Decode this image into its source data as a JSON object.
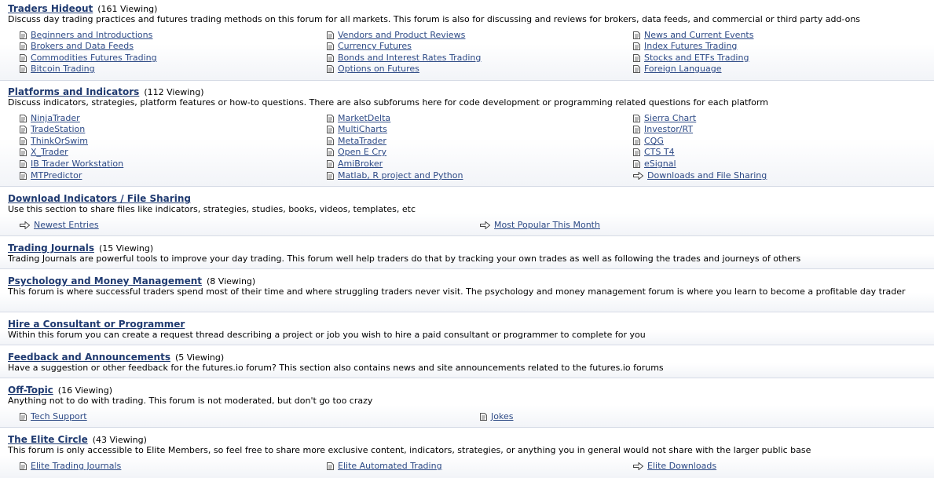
{
  "forums": {
    "traders_hideout": {
      "title": "Traders Hideout",
      "viewing": "(161 Viewing)",
      "description": "Discuss day trading practices and futures trading methods on this forum for all markets. This forum is also for discussing and reviews for brokers, data feeds, and commercial or third party add-ons",
      "subforums": [
        "Beginners and Introductions",
        "Brokers and Data Feeds",
        "Commodities Futures Trading",
        "Bitcoin Trading",
        "Vendors and Product Reviews",
        "Currency Futures",
        "Bonds and Interest Rates Trading",
        "Options on Futures",
        "News and Current Events",
        "Index Futures Trading",
        "Stocks and ETFs Trading",
        "Foreign Language"
      ]
    },
    "platforms": {
      "title": "Platforms and Indicators",
      "viewing": "(112 Viewing)",
      "description": "Discuss indicators, strategies, platform features or how-to questions. There are also subforums here for code development or programming related questions for each platform",
      "subforums": [
        "NinjaTrader",
        "TradeStation",
        "ThinkOrSwim",
        "X_Trader",
        "IB Trader Workstation",
        "MTPredictor",
        "MarketDelta",
        "MultiCharts",
        "MetaTrader",
        "Open E Cry",
        "AmiBroker",
        "Matlab, R project and Python",
        "Sierra Chart",
        "Investor/RT",
        "CQG",
        "CTS T4",
        "eSignal",
        "Downloads and File Sharing"
      ]
    },
    "download": {
      "title": "Download Indicators / File Sharing",
      "description": "Use this section to share files like indicators, strategies, studies, books, videos, templates, etc",
      "links": [
        "Newest Entries",
        "Most Popular This Month"
      ]
    },
    "journals": {
      "title": "Trading Journals",
      "viewing": "(15 Viewing)",
      "description": "Trading Journals are powerful tools to improve your day trading. This forum well help traders do that by tracking your own trades as well as following the trades and journeys of others"
    },
    "psychology": {
      "title": "Psychology and Money Management",
      "viewing": "(8 Viewing)",
      "description": "This forum is where successful traders spend most of their time and where struggling traders never visit. The psychology and money management forum is where you learn to become a profitable day trader"
    },
    "hire": {
      "title": "Hire a Consultant or Programmer",
      "description": "Within this forum you can create a request thread describing a project or job you wish to hire a paid consultant or programmer to complete for you"
    },
    "feedback": {
      "title": "Feedback and Announcements",
      "viewing": "(5 Viewing)",
      "description": "Have a suggestion or other feedback for the futures.io forum? This section also contains news and site announcements related to the futures.io forums"
    },
    "offtopic": {
      "title": "Off-Topic",
      "viewing": "(16 Viewing)",
      "description": "Anything not to do with trading. This forum is not moderated, but don't go too crazy",
      "subforums": [
        "Tech Support",
        "Jokes"
      ]
    },
    "elite": {
      "title": "The Elite Circle",
      "viewing": "(43 Viewing)",
      "description": "This forum is only accessible to Elite Members, so feel free to share more exclusive content, indicators, strategies, or anything you in general would not share with the larger public base",
      "subforums": [
        "Elite Trading Journals",
        "Elite Automated Trading",
        "Elite Downloads"
      ]
    }
  },
  "icons": {
    "subforum": "page-icon",
    "link": "arrow-right-icon"
  },
  "colors": {
    "link": "#2d4a86",
    "title": "#1f3a70",
    "divider": "#d6dbe6",
    "row_fade": "#f2f4f8"
  }
}
